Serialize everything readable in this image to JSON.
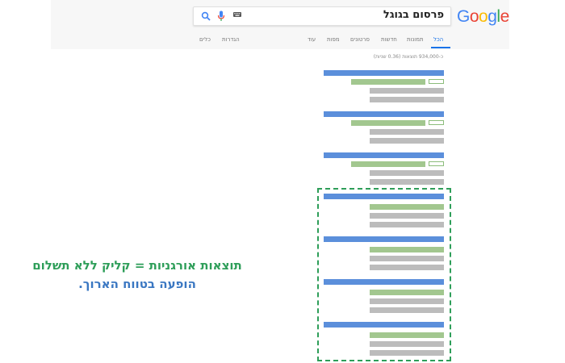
{
  "logo": {
    "letters": [
      "G",
      "o",
      "o",
      "g",
      "l",
      "e"
    ],
    "colors": [
      "#4285f4",
      "#ea4335",
      "#fbbc05",
      "#4285f4",
      "#34a853",
      "#ea4335"
    ]
  },
  "search": {
    "query": "פרסום בגוגל"
  },
  "tabs": [
    {
      "label": "הכל",
      "active": true
    },
    {
      "label": "תמונות"
    },
    {
      "label": "חדשות"
    },
    {
      "label": "סרטונים"
    },
    {
      "label": "מפות"
    },
    {
      "label": "עוד"
    },
    {
      "label": "הגדרות"
    },
    {
      "label": "כלים"
    }
  ],
  "stats": "כ-934,000 תוצאות (0.36 שניות)",
  "caption": {
    "line1": "תוצאות אורגניות = קליק ללא תשלום",
    "line2": "הופעה בטווח הארוך."
  },
  "colors": {
    "title": "#5b8fdb",
    "url": "#a2c78f",
    "description": "#bcbcbc",
    "highlight": "#2e9e59"
  }
}
